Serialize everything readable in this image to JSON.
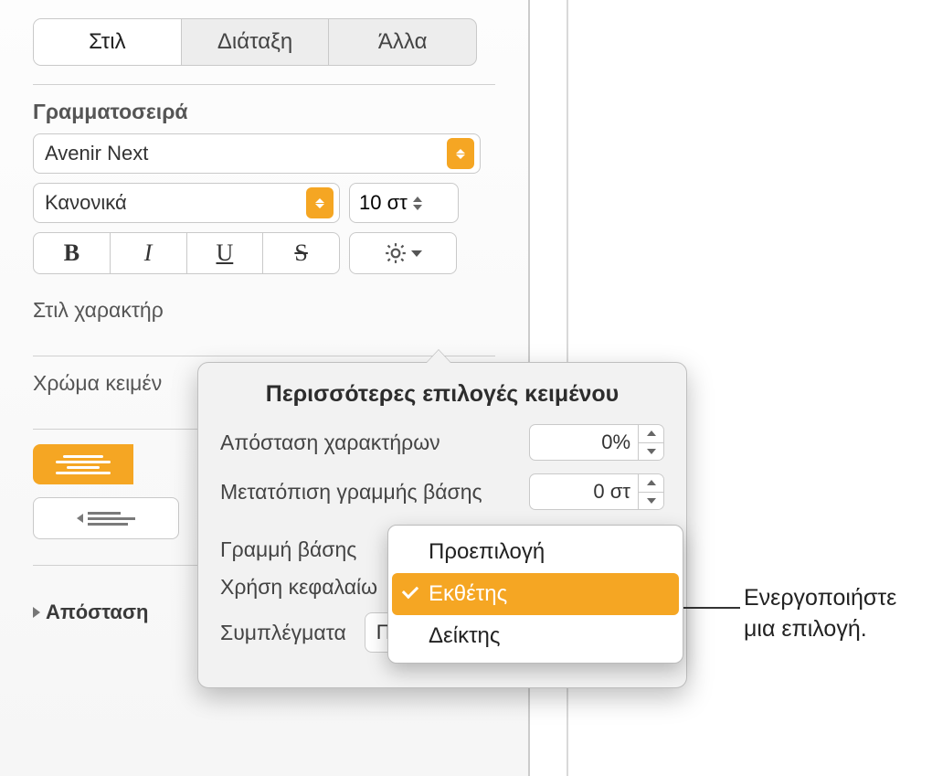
{
  "tabs": {
    "style": "Στιλ",
    "layout": "Διάταξη",
    "more": "Άλλα"
  },
  "font": {
    "section": "Γραμματοσειρά",
    "family": "Avenir Next",
    "weight": "Κανονικά",
    "size": "10 στ"
  },
  "labels": {
    "char_style": "Στιλ χαρακτήρ",
    "text_color": "Χρώμα κειμέν",
    "spacing": "Απόσταση"
  },
  "popover": {
    "title": "Περισσότερες επιλογές κειμένου",
    "char_spacing_label": "Απόσταση χαρακτήρων",
    "char_spacing_value": "0%",
    "baseline_shift_label": "Μετατόπιση γραμμής βάσης",
    "baseline_shift_value": "0 στ",
    "baseline_label": "Γραμμή βάσης",
    "caps_label": "Χρήση κεφαλαίω",
    "ligatures_label": "Συμπλέγματα",
    "ligatures_value": "Προεπιλογή"
  },
  "menu": {
    "opt_default": "Προεπιλογή",
    "opt_superscript": "Εκθέτης",
    "opt_subscript": "Δείκτης"
  },
  "annotation": {
    "line1": "Ενεργοποιήστε",
    "line2": "μια επιλογή."
  },
  "colors": {
    "accent": "#f5a623"
  }
}
